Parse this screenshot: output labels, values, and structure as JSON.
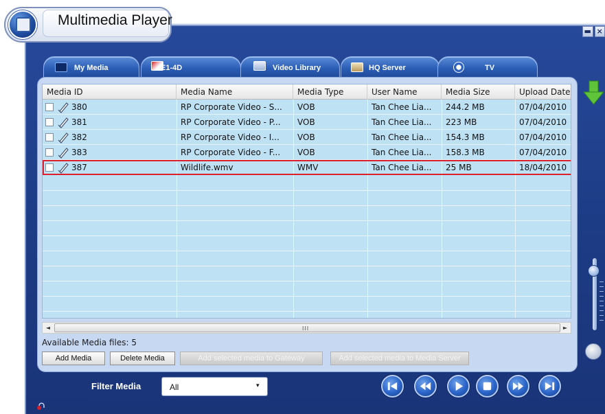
{
  "app": {
    "title": "Multimedia Player"
  },
  "window_controls": {
    "minimize": "▬",
    "close": "×"
  },
  "tabs": [
    {
      "label": "My Media",
      "icon": "film-icon"
    },
    {
      "label": "E1-4D",
      "icon": "folder-icon"
    },
    {
      "label": "Video Library",
      "icon": "library-icon"
    },
    {
      "label": "HQ Server",
      "icon": "server-icon"
    },
    {
      "label": "TV",
      "icon": "tv-icon"
    }
  ],
  "table": {
    "columns": [
      "Media ID",
      "Media Name",
      "Media Type",
      "User Name",
      "Media Size",
      "Upload Date"
    ],
    "rows": [
      {
        "id": "380",
        "name": "RP Corporate Video - S...",
        "type": "VOB",
        "user": "Tan Chee Lia...",
        "size": "244.2 MB",
        "date": "07/04/2010"
      },
      {
        "id": "381",
        "name": "RP Corporate Video - P...",
        "type": "VOB",
        "user": "Tan Chee Lia...",
        "size": "223 MB",
        "date": "07/04/2010"
      },
      {
        "id": "382",
        "name": "RP Corporate Video - I...",
        "type": "VOB",
        "user": "Tan Chee Lia...",
        "size": "154.3 MB",
        "date": "07/04/2010"
      },
      {
        "id": "383",
        "name": "RP Corporate Video - F...",
        "type": "VOB",
        "user": "Tan Chee Lia...",
        "size": "158.3 MB",
        "date": "07/04/2010"
      },
      {
        "id": "387",
        "name": "Wildlife.wmv",
        "type": "WMV",
        "user": "Tan Chee Lia...",
        "size": "25 MB",
        "date": "18/04/2010"
      }
    ],
    "selected_row_id": "387"
  },
  "scrollbar": {
    "left": "◄",
    "right": "►",
    "grip": "III"
  },
  "status": {
    "available_text": "Available Media files: 5"
  },
  "actions": {
    "add_media": "Add Media",
    "delete_media": "Delete Media",
    "add_to_gateway": "Add selected media to Gateway",
    "add_to_server": "Add selected media to Media Server"
  },
  "filter": {
    "label": "Filter Media",
    "value": "All",
    "dropdown": "▾"
  },
  "player_controls": [
    "skip-back",
    "rewind",
    "play",
    "stop",
    "fast-forward",
    "skip-forward"
  ],
  "colors": {
    "frame": "#1f3f8a",
    "table_bg": "#bfe1f4",
    "selection_outline": "#dd1f2b",
    "accent_arrow": "#5fc43a"
  }
}
